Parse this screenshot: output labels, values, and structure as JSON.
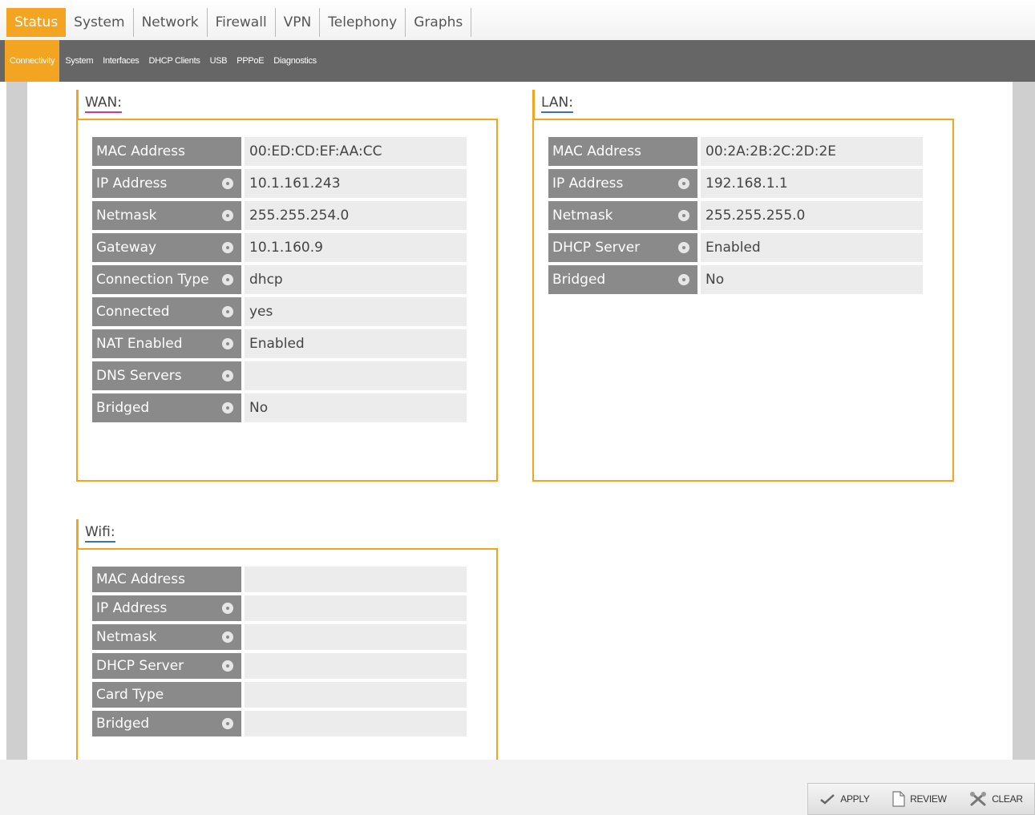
{
  "top_tabs": [
    {
      "label": "Status"
    },
    {
      "label": "System"
    },
    {
      "label": "Network"
    },
    {
      "label": "Firewall"
    },
    {
      "label": "VPN"
    },
    {
      "label": "Telephony"
    },
    {
      "label": "Graphs"
    }
  ],
  "sub_tabs": [
    {
      "label": "Connectivity"
    },
    {
      "label": "System"
    },
    {
      "label": "Interfaces"
    },
    {
      "label": "DHCP Clients"
    },
    {
      "label": "USB"
    },
    {
      "label": "PPPoE"
    },
    {
      "label": "Diagnostics"
    }
  ],
  "wan": {
    "title": "WAN:",
    "rows": [
      {
        "label": "MAC Address",
        "value": "00:ED:CD:EF:AA:CC",
        "gear": false
      },
      {
        "label": "IP Address",
        "value": "10.1.161.243",
        "gear": true
      },
      {
        "label": "Netmask",
        "value": "255.255.254.0",
        "gear": true
      },
      {
        "label": "Gateway",
        "value": "10.1.160.9",
        "gear": true
      },
      {
        "label": "Connection Type",
        "value": "dhcp",
        "gear": true
      },
      {
        "label": "Connected",
        "value": "yes",
        "gear": true
      },
      {
        "label": "NAT Enabled",
        "value": "Enabled",
        "gear": true
      },
      {
        "label": "DNS Servers",
        "value": "",
        "gear": true
      },
      {
        "label": "Bridged",
        "value": "No",
        "gear": true
      }
    ]
  },
  "lan": {
    "title": "LAN:",
    "rows": [
      {
        "label": "MAC Address",
        "value": "00:2A:2B:2C:2D:2E",
        "gear": false
      },
      {
        "label": "IP Address",
        "value": "192.168.1.1",
        "gear": true
      },
      {
        "label": "Netmask",
        "value": "255.255.255.0",
        "gear": true
      },
      {
        "label": "DHCP Server",
        "value": "Enabled",
        "gear": true
      },
      {
        "label": "Bridged",
        "value": "No",
        "gear": true
      }
    ]
  },
  "wifi": {
    "title": "Wifi:",
    "rows": [
      {
        "label": "MAC Address",
        "value": "",
        "gear": false
      },
      {
        "label": "IP Address",
        "value": "",
        "gear": true
      },
      {
        "label": "Netmask",
        "value": "",
        "gear": true
      },
      {
        "label": "DHCP Server",
        "value": "",
        "gear": true
      },
      {
        "label": "Card Type",
        "value": "",
        "gear": false
      },
      {
        "label": "Bridged",
        "value": "",
        "gear": true
      }
    ]
  },
  "actions": {
    "apply": "APPLY",
    "review": "REVIEW",
    "clear": "CLEAR"
  },
  "colors": {
    "accent": "#f3a521",
    "subbar": "#666666",
    "label_bg": "#8a8a8a",
    "value_bg": "#ececec"
  },
  "icons": {
    "row_gear": "gear-icon",
    "apply": "checkmark-icon",
    "review": "document-icon",
    "clear": "broom-icon"
  }
}
